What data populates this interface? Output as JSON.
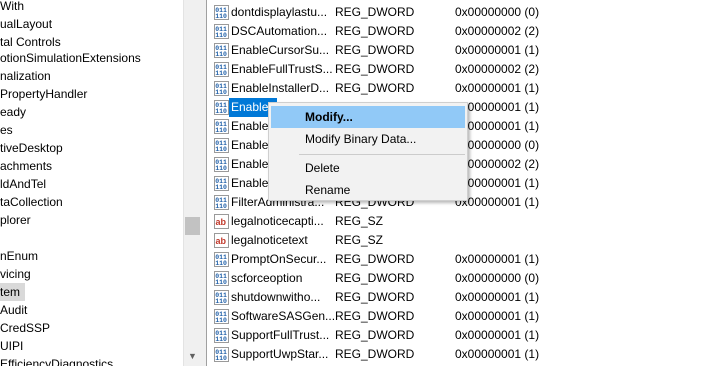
{
  "tree": {
    "items": [
      "With",
      "ualLayout",
      "tal Controls",
      "otionSimulationExtensions",
      "nalization",
      "PropertyHandler",
      "eady",
      "es",
      "tiveDesktop",
      "achments",
      "ldAndTel",
      "taCollection",
      "plorer",
      "",
      "nEnum",
      "vicing",
      "tem",
      "Audit",
      "CredSSP",
      "UIPI",
      "EfficiencyDiagnostics"
    ],
    "selected_index": 16
  },
  "values": {
    "rows": [
      {
        "icon": "reg-binary-icon",
        "name": "dontdisplaylastu...",
        "type": "REG_DWORD",
        "data": "0x00000000 (0)"
      },
      {
        "icon": "reg-binary-icon",
        "name": "DSCAutomation...",
        "type": "REG_DWORD",
        "data": "0x00000002 (2)"
      },
      {
        "icon": "reg-binary-icon",
        "name": "EnableCursorSu...",
        "type": "REG_DWORD",
        "data": "0x00000001 (1)"
      },
      {
        "icon": "reg-binary-icon",
        "name": "EnableFullTrustS...",
        "type": "REG_DWORD",
        "data": "0x00000002 (2)"
      },
      {
        "icon": "reg-binary-icon",
        "name": "EnableInstallerD...",
        "type": "REG_DWORD",
        "data": "0x00000001 (1)"
      },
      {
        "icon": "reg-binary-icon",
        "name": "EnableL",
        "type": "",
        "data": "0x00000001 (1)"
      },
      {
        "icon": "reg-binary-icon",
        "name": "EnableS",
        "type": "",
        "data": "0x00000001 (1)"
      },
      {
        "icon": "reg-binary-icon",
        "name": "EnableU",
        "type": "",
        "data": "0x00000000 (0)"
      },
      {
        "icon": "reg-binary-icon",
        "name": "EnableU",
        "type": "",
        "data": "0x00000002 (2)"
      },
      {
        "icon": "reg-binary-icon",
        "name": "EnableV",
        "type": "",
        "data": "0x00000001 (1)"
      },
      {
        "icon": "reg-binary-icon",
        "name": "FilterAdministra...",
        "type": "REG_DWORD",
        "data": "0x00000001 (1)"
      },
      {
        "icon": "reg-string-icon",
        "name": "legalnoticecapti...",
        "type": "REG_SZ",
        "data": ""
      },
      {
        "icon": "reg-string-icon",
        "name": "legalnoticetext",
        "type": "REG_SZ",
        "data": ""
      },
      {
        "icon": "reg-binary-icon",
        "name": "PromptOnSecur...",
        "type": "REG_DWORD",
        "data": "0x00000001 (1)"
      },
      {
        "icon": "reg-binary-icon",
        "name": "scforceoption",
        "type": "REG_DWORD",
        "data": "0x00000000 (0)"
      },
      {
        "icon": "reg-binary-icon",
        "name": "shutdownwitho...",
        "type": "REG_DWORD",
        "data": "0x00000001 (1)"
      },
      {
        "icon": "reg-binary-icon",
        "name": "SoftwareSASGen...",
        "type": "REG_DWORD",
        "data": "0x00000001 (1)"
      },
      {
        "icon": "reg-binary-icon",
        "name": "SupportFullTrust...",
        "type": "REG_DWORD",
        "data": "0x00000001 (1)"
      },
      {
        "icon": "reg-binary-icon",
        "name": "SupportUwpStar...",
        "type": "REG_DWORD",
        "data": "0x00000001 (1)"
      }
    ],
    "selected_index": 5
  },
  "context_menu": {
    "modify": "Modify...",
    "modify_binary": "Modify Binary Data...",
    "delete": "Delete",
    "rename": "Rename"
  },
  "colors": {
    "selection": "#0078d7",
    "menu_highlight": "#91c9f7"
  }
}
